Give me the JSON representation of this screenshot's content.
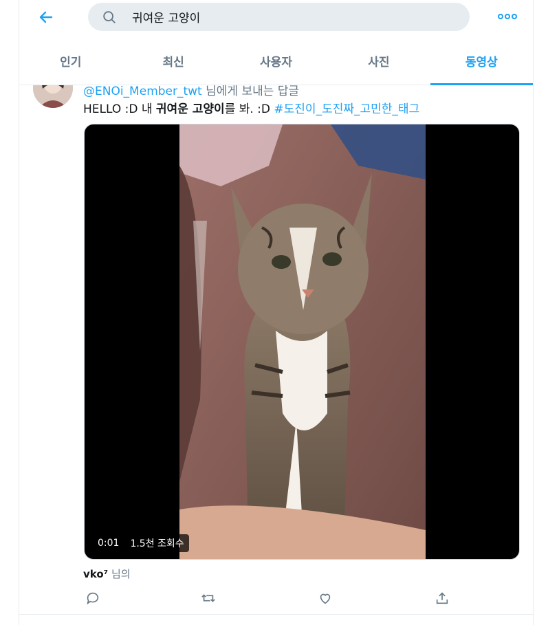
{
  "header": {
    "back_icon": "arrow-left-icon",
    "search": {
      "value": "귀여운 고양이",
      "icon": "search-icon"
    },
    "more_icon": "more-dots-icon"
  },
  "tabs": [
    {
      "label": "인기",
      "active": false
    },
    {
      "label": "최신",
      "active": false
    },
    {
      "label": "사용자",
      "active": false
    },
    {
      "label": "사진",
      "active": false
    },
    {
      "label": "동영상",
      "active": true
    }
  ],
  "tweet": {
    "reply_mention": "@ENOi_Member_twt",
    "reply_suffix": "님에게 보내는 답글",
    "text_plain_1": "HELLO :D 내 ",
    "text_bold": "귀여운 고양이",
    "text_plain_2": "를 봐. :D ",
    "text_hashtag": "#도진이_도진짜_고민한_태그",
    "video": {
      "time": "0:01",
      "views": "1.5천 조회수"
    },
    "attribution_user": "vko⁷",
    "attribution_suffix": "님의",
    "actions": [
      "reply-icon",
      "retweet-icon",
      "like-icon",
      "share-icon"
    ]
  },
  "colors": {
    "accent": "#1da1f2",
    "muted": "#657786",
    "text": "#14171a",
    "border": "#e6ecf0"
  }
}
